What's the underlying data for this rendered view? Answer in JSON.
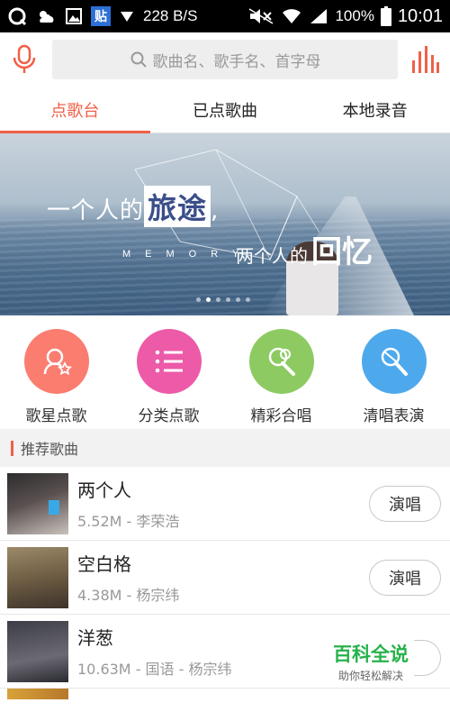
{
  "status_bar": {
    "network_speed": "228 B/S",
    "tieba_label": "贴",
    "battery": "100%",
    "time": "10:01"
  },
  "header": {
    "search_placeholder": "歌曲名、歌手名、首字母"
  },
  "tabs": [
    {
      "label": "点歌台",
      "active": true
    },
    {
      "label": "已点歌曲",
      "active": false
    },
    {
      "label": "本地录音",
      "active": false
    }
  ],
  "banner": {
    "line1_prefix": "一个人的",
    "line1_big": "旅途",
    "line1_suffix": ",",
    "memory": "MEMORY",
    "line2_prefix": "两个人的",
    "line2_big": "回忆",
    "page_count": 6,
    "current_page": 2
  },
  "categories": [
    {
      "label": "歌星点歌",
      "icon": "singer-star-icon",
      "color": "#fa7d70"
    },
    {
      "label": "分类点歌",
      "icon": "list-icon",
      "color": "#ec5aa8"
    },
    {
      "label": "精彩合唱",
      "icon": "duet-microphone-icon",
      "color": "#8dcb62"
    },
    {
      "label": "清唱表演",
      "icon": "microphone-icon",
      "color": "#4da9ec"
    }
  ],
  "recommended": {
    "title": "推荐歌曲",
    "songs": [
      {
        "title": "两个人",
        "meta": "5.52M - 李荣浩",
        "button": "演唱"
      },
      {
        "title": "空白格",
        "meta": "4.38M - 杨宗纬",
        "button": "演唱"
      },
      {
        "title": "洋葱",
        "meta": "10.63M - 国语 - 杨宗纬",
        "button": "演唱"
      }
    ]
  },
  "watermark": {
    "title": "百科全说",
    "subtitle": "助你轻松解决"
  },
  "colors": {
    "accent": "#f06048"
  }
}
